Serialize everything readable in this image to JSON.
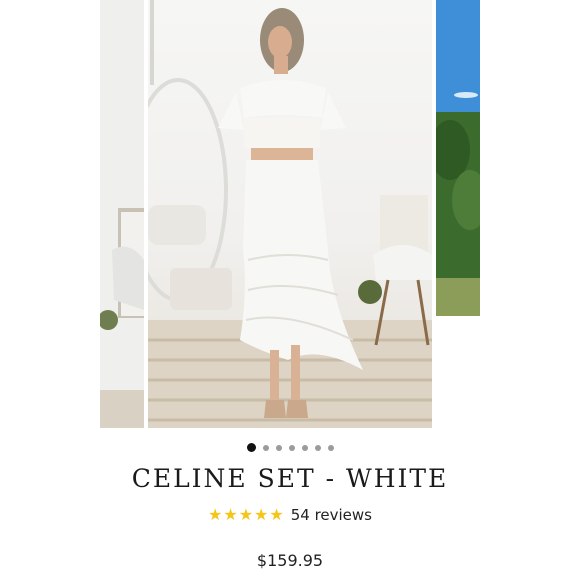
{
  "product": {
    "title": "CELINE SET - WHITE",
    "rating_stars": "★★★★★",
    "rating_value": 5,
    "reviews_label": "54 reviews",
    "price": "$159.95"
  },
  "gallery": {
    "slide_count": 7,
    "active_index": 0
  },
  "colors": {
    "star": "#f5c518",
    "dot_active": "#111111",
    "dot_inactive": "#9b9b9b"
  },
  "icons": {
    "zoom": "search-icon"
  }
}
